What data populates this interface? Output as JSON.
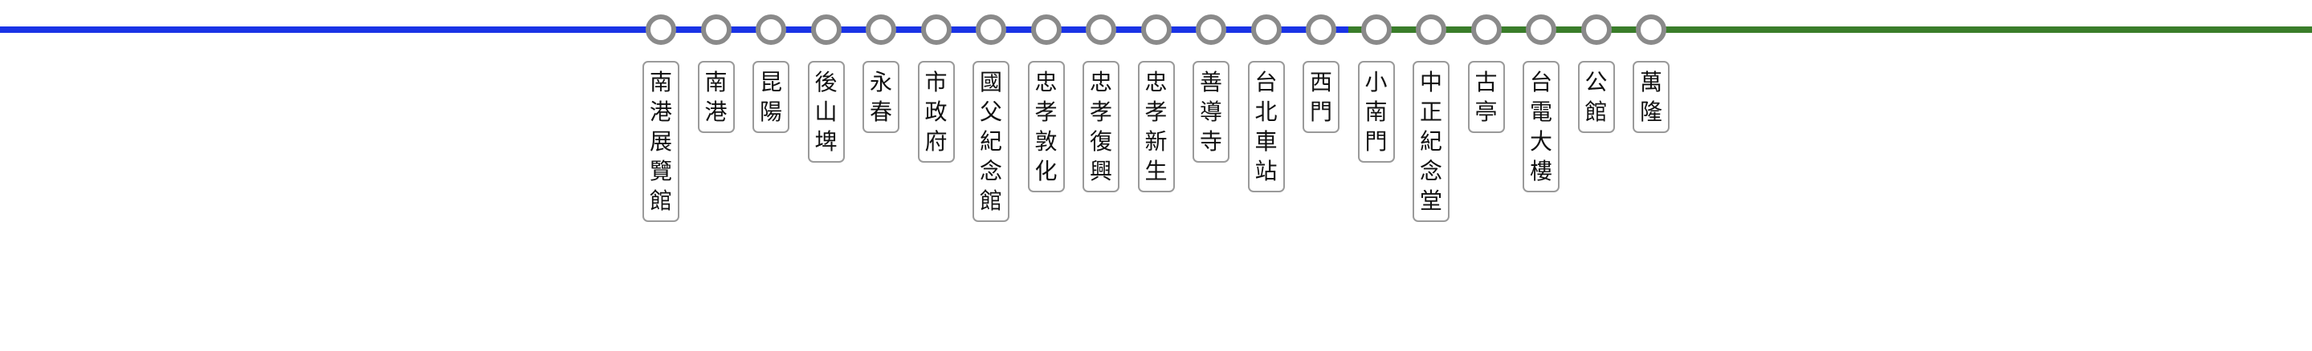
{
  "line_colors": {
    "blue": "#1a33e6",
    "green": "#3a7d2a",
    "station_ring": "#8a8a8a",
    "label_border": "#9a9a9a"
  },
  "segment_colors": [
    "blue",
    "green"
  ],
  "stations": [
    {
      "name": "南港展覽館",
      "color": "blue"
    },
    {
      "name": "南港",
      "color": "blue"
    },
    {
      "name": "昆陽",
      "color": "blue"
    },
    {
      "name": "後山埤",
      "color": "blue"
    },
    {
      "name": "永春",
      "color": "blue"
    },
    {
      "name": "市政府",
      "color": "blue"
    },
    {
      "name": "國父紀念館",
      "color": "blue"
    },
    {
      "name": "忠孝敦化",
      "color": "blue"
    },
    {
      "name": "忠孝復興",
      "color": "blue"
    },
    {
      "name": "忠孝新生",
      "color": "blue"
    },
    {
      "name": "善導寺",
      "color": "blue"
    },
    {
      "name": "台北車站",
      "color": "blue"
    },
    {
      "name": "西門",
      "color": "blue"
    },
    {
      "name": "小南門",
      "color": "green"
    },
    {
      "name": "中正紀念堂",
      "color": "green"
    },
    {
      "name": "古亭",
      "color": "green"
    },
    {
      "name": "台電大樓",
      "color": "green"
    },
    {
      "name": "公館",
      "color": "green"
    },
    {
      "name": "萬隆",
      "color": "green"
    }
  ]
}
